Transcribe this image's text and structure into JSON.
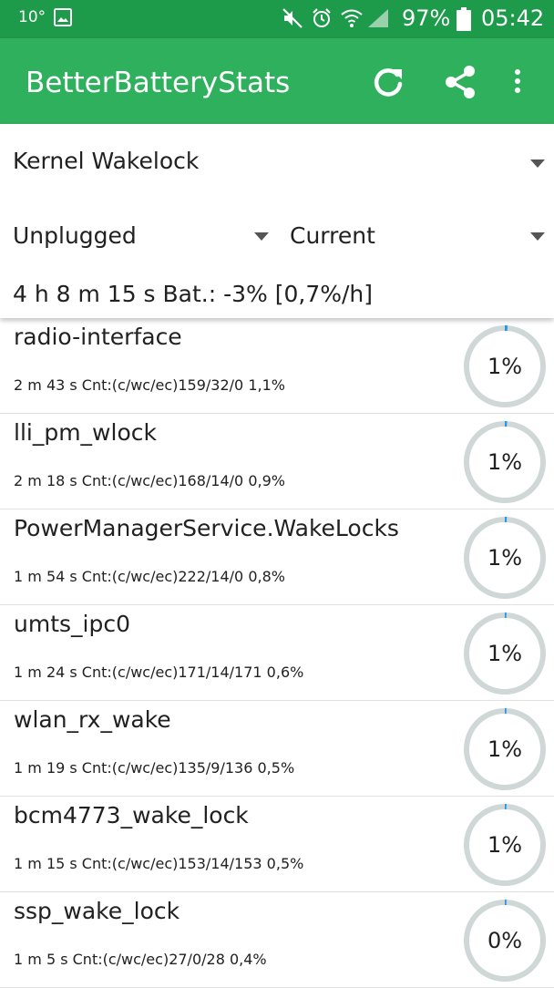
{
  "status_bar": {
    "temperature": "10°",
    "battery_percent": "97%",
    "time": "05:42",
    "icons": [
      "image-icon",
      "mute-icon",
      "alarm-icon",
      "wifi-icon",
      "signal-icon",
      "battery-icon"
    ]
  },
  "app_bar": {
    "title": "BetterBatteryStats",
    "actions": [
      "refresh-icon",
      "share-icon",
      "more-options-icon"
    ],
    "color": "#2eb05c",
    "status_color": "#1e9a4b"
  },
  "filters": {
    "stat_type": "Kernel Wakelock",
    "from_ref": "Unplugged",
    "to_ref": "Current",
    "summary": "4 h 8 m 15 s  Bat.: -3% [0,7%/h]"
  },
  "gauge_colors": {
    "track": "#cfd8d6",
    "progress": "#2196f3"
  },
  "wakelocks": [
    {
      "name": "radio-interface",
      "details": "2 m 43 s  Cnt:(c/wc/ec)159/32/0 1,1%",
      "percent_label": "1%",
      "percent_value": 1.1
    },
    {
      "name": "lli_pm_wlock",
      "details": "2 m 18 s  Cnt:(c/wc/ec)168/14/0 0,9%",
      "percent_label": "1%",
      "percent_value": 0.9
    },
    {
      "name": "PowerManagerService.WakeLocks",
      "details": "1 m 54 s  Cnt:(c/wc/ec)222/14/0 0,8%",
      "percent_label": "1%",
      "percent_value": 0.8
    },
    {
      "name": "umts_ipc0",
      "details": "1 m 24 s  Cnt:(c/wc/ec)171/14/171 0,6%",
      "percent_label": "1%",
      "percent_value": 0.6
    },
    {
      "name": "wlan_rx_wake",
      "details": "1 m 19 s  Cnt:(c/wc/ec)135/9/136 0,5%",
      "percent_label": "1%",
      "percent_value": 0.5
    },
    {
      "name": "bcm4773_wake_lock",
      "details": "1 m 15 s  Cnt:(c/wc/ec)153/14/153 0,5%",
      "percent_label": "1%",
      "percent_value": 0.5
    },
    {
      "name": "ssp_wake_lock",
      "details": "1 m 5 s  Cnt:(c/wc/ec)27/0/28 0,4%",
      "percent_label": "0%",
      "percent_value": 0.4
    }
  ]
}
